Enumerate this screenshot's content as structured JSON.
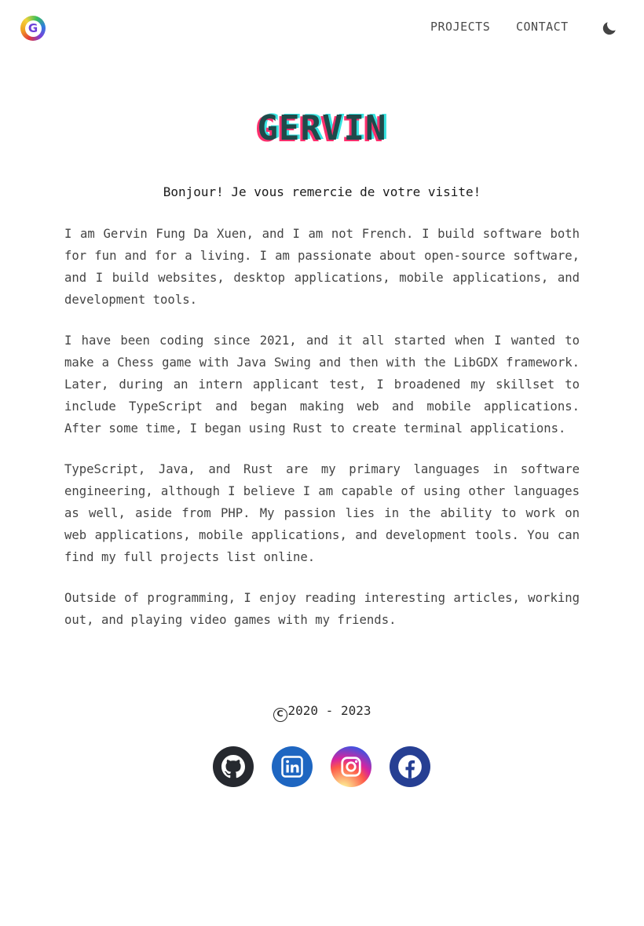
{
  "header": {
    "logo_letter": "G",
    "nav": [
      {
        "label": "PROJECTS"
      },
      {
        "label": "CONTACT"
      }
    ],
    "theme_toggle_icon": "moon-icon"
  },
  "hero": {
    "title": "GERVIN",
    "greeting": "Bonjour! Je vous remercie de votre visite!"
  },
  "about": {
    "paragraphs": [
      "I am Gervin Fung Da Xuen, and I am not French. I build software both for fun and for a living. I am passionate about open-source software, and I build websites, desktop applications, mobile applications, and development tools.",
      "I have been coding since 2021, and it all started when I wanted to make a Chess game with Java Swing and then with the LibGDX framework. Later, during an intern applicant test, I broadened my skillset to include TypeScript and began making web and mobile applications. After some time, I began using Rust to create terminal applications.",
      "TypeScript, Java, and Rust are my primary languages in software engineering, although I believe I am capable of using other languages as well, aside from PHP. My passion lies in the ability to work on web applications, mobile applications, and development tools. You can find my full projects list online.",
      "Outside of programming, I enjoy reading interesting articles, working out, and playing video games with my friends."
    ]
  },
  "footer": {
    "copyright_symbol": "C",
    "copyright_years": "2020 - 2023",
    "socials": [
      {
        "icon": "github-icon",
        "color": "#26292f"
      },
      {
        "icon": "linkedin-icon",
        "color": "#1e66c1"
      },
      {
        "icon": "instagram-icon",
        "color": "#d6249f"
      },
      {
        "icon": "facebook-icon",
        "color": "#263f93"
      }
    ]
  },
  "colors": {
    "title_text": "#1f4a4a",
    "title_shadow_pink": "#ff2f6d",
    "title_shadow_cyan": "#35e3e0",
    "body_text": "#444444"
  }
}
